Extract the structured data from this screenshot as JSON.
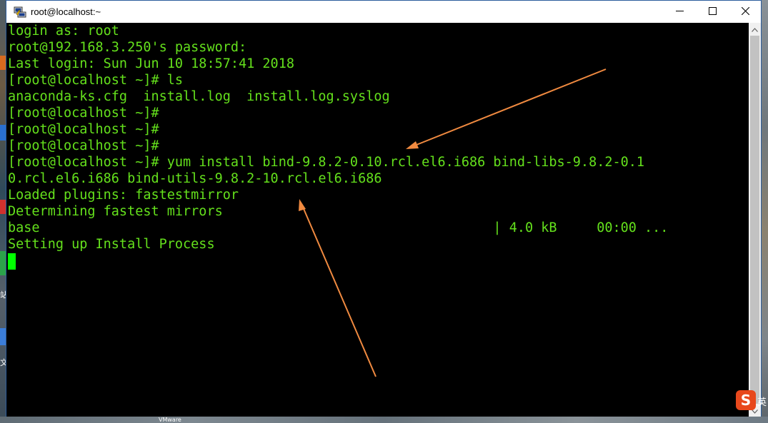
{
  "window": {
    "title": "root@localhost:~"
  },
  "terminal": {
    "lines": [
      "login as: root",
      "root@192.168.3.250's password:",
      "Last login: Sun Jun 10 18:57:41 2018",
      "[root@localhost ~]# ls",
      "anaconda-ks.cfg  install.log  install.log.syslog",
      "[root@localhost ~]#",
      "[root@localhost ~]#",
      "[root@localhost ~]#",
      "[root@localhost ~]# yum install bind-9.8.2-0.10.rcl.el6.i686 bind-libs-9.8.2-0.1",
      "0.rcl.el6.i686 bind-utils-9.8.2-10.rcl.el6.i686",
      "Loaded plugins: fastestmirror",
      "Determining fastest mirrors",
      "base                                                         | 4.0 kB     00:00 ...",
      "Setting up Install Process"
    ]
  },
  "desktop": {
    "ime_label": "S",
    "ime_text": "英",
    "left_text_1": "站",
    "left_text_2": "文",
    "taskbar_label": "VMware"
  },
  "colors": {
    "terminal_text": "#64e01c",
    "terminal_bg": "#000000",
    "cursor": "#00ff00",
    "arrow": "#f08a40"
  },
  "icons": {
    "app": "putty-icon",
    "minimize": "minimize-icon",
    "maximize": "maximize-icon",
    "close": "close-icon"
  }
}
